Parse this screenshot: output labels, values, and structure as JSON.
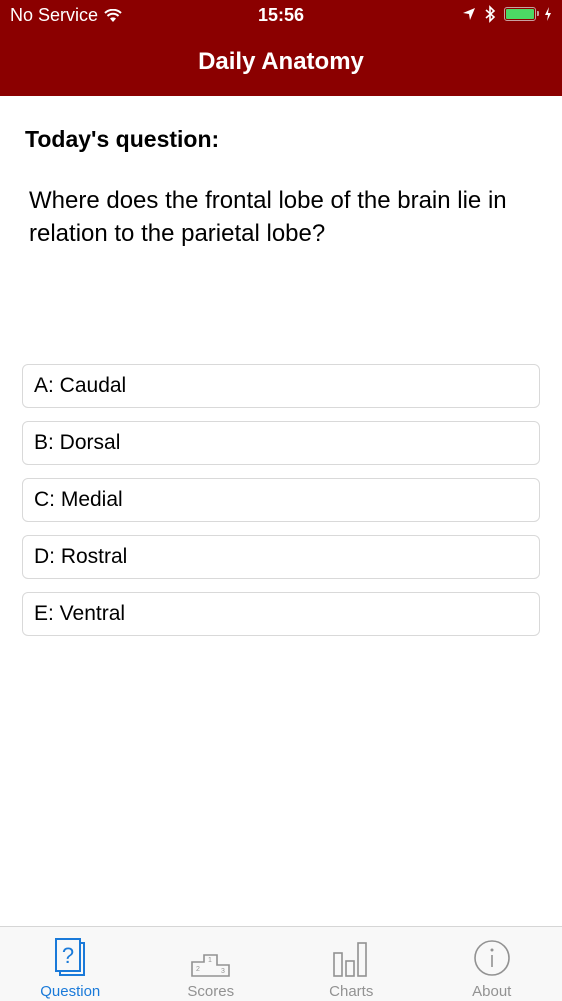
{
  "status_bar": {
    "carrier": "No Service",
    "time": "15:56",
    "battery_level": 1.0,
    "icons": [
      "wifi-icon",
      "location-arrow-icon",
      "bluetooth-icon",
      "battery-icon",
      "charging-bolt-icon"
    ]
  },
  "header": {
    "title": "Daily Anatomy",
    "background": "#8b0000"
  },
  "question": {
    "label": "Today's question:",
    "text": "Where does the frontal lobe of the brain lie in relation to the parietal lobe?"
  },
  "answers": [
    {
      "label": "A: Caudal"
    },
    {
      "label": "B: Dorsal"
    },
    {
      "label": "C: Medial"
    },
    {
      "label": "D: Rostral"
    },
    {
      "label": "E: Ventral"
    }
  ],
  "tab_bar": {
    "active_color": "#1a7ad9",
    "inactive_color": "#929292",
    "tabs": [
      {
        "label": "Question",
        "icon": "question-card-icon",
        "active": true
      },
      {
        "label": "Scores",
        "icon": "podium-icon",
        "active": false
      },
      {
        "label": "Charts",
        "icon": "bar-chart-icon",
        "active": false
      },
      {
        "label": "About",
        "icon": "info-icon",
        "active": false
      }
    ]
  }
}
